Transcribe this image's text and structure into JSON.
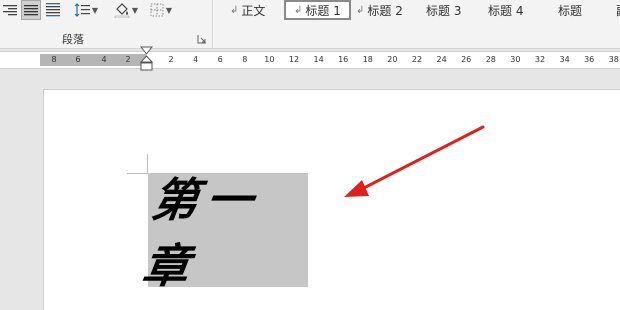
{
  "ribbon": {
    "paragraph_group": {
      "label": "段落",
      "buttons": [
        {
          "name": "align-right",
          "icon": "align-right-icon"
        },
        {
          "name": "justify",
          "icon": "justify-icon",
          "active": true
        },
        {
          "name": "distributed",
          "icon": "distribute-icon"
        },
        {
          "name": "line-spacing",
          "icon": "line-spacing-icon"
        },
        {
          "name": "shading",
          "icon": "paint-bucket-icon"
        },
        {
          "name": "borders",
          "icon": "borders-icon"
        }
      ]
    },
    "styles": [
      {
        "label": "正文",
        "marker": "↲"
      },
      {
        "label": "标题 1",
        "marker": "↲",
        "selected": true
      },
      {
        "label": "标题 2",
        "marker": "↲"
      },
      {
        "label": "标题 3"
      },
      {
        "label": "标题 4"
      },
      {
        "label": "标题"
      },
      {
        "label": "副"
      }
    ]
  },
  "ruler": {
    "left_ticks": [
      "8",
      "6",
      "4",
      "2"
    ],
    "right_ticks": [
      "2",
      "4",
      "6",
      "8",
      "10",
      "12",
      "14",
      "16",
      "18",
      "20",
      "22",
      "24",
      "26",
      "28",
      "30",
      "32",
      "34",
      "36",
      "38"
    ]
  },
  "document": {
    "heading_text": "第一章",
    "highlight_color": "#c6c6c6"
  },
  "annotation": {
    "arrow_color": "#e0201b"
  }
}
